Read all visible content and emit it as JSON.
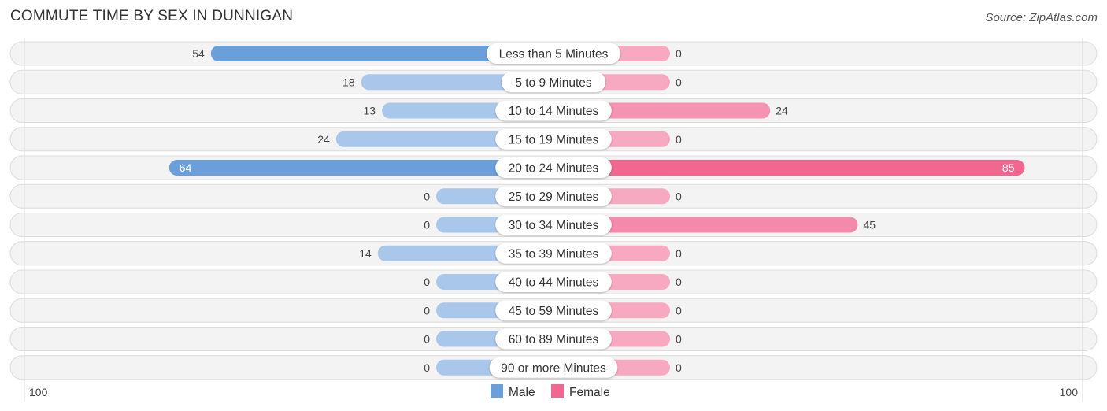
{
  "header": {
    "title": "COMMUTE TIME BY SEX IN DUNNIGAN",
    "source": "Source: ZipAtlas.com"
  },
  "colors": {
    "male_strong": "#6a9fda",
    "male_light": "#a9c7ea",
    "female_strong": "#f06890",
    "female_light": "#f7a9c1",
    "row_bg": "#f3f3f3"
  },
  "chart_data": {
    "type": "bar",
    "orientation": "horizontal-diverging",
    "title": "COMMUTE TIME BY SEX IN DUNNIGAN",
    "categories": [
      "Less than 5 Minutes",
      "5 to 9 Minutes",
      "10 to 14 Minutes",
      "15 to 19 Minutes",
      "20 to 24 Minutes",
      "25 to 29 Minutes",
      "30 to 34 Minutes",
      "35 to 39 Minutes",
      "40 to 44 Minutes",
      "45 to 59 Minutes",
      "60 to 89 Minutes",
      "90 or more Minutes"
    ],
    "series": [
      {
        "name": "Male",
        "values": [
          54,
          18,
          13,
          24,
          64,
          0,
          0,
          14,
          0,
          0,
          0,
          0
        ]
      },
      {
        "name": "Female",
        "values": [
          0,
          0,
          24,
          0,
          85,
          0,
          45,
          0,
          0,
          0,
          0,
          0
        ]
      }
    ],
    "axis": {
      "left_label": "100",
      "right_label": "100",
      "range": [
        0,
        100
      ]
    },
    "legend": {
      "position": "bottom-center",
      "items": [
        "Male",
        "Female"
      ]
    },
    "grid": false
  }
}
